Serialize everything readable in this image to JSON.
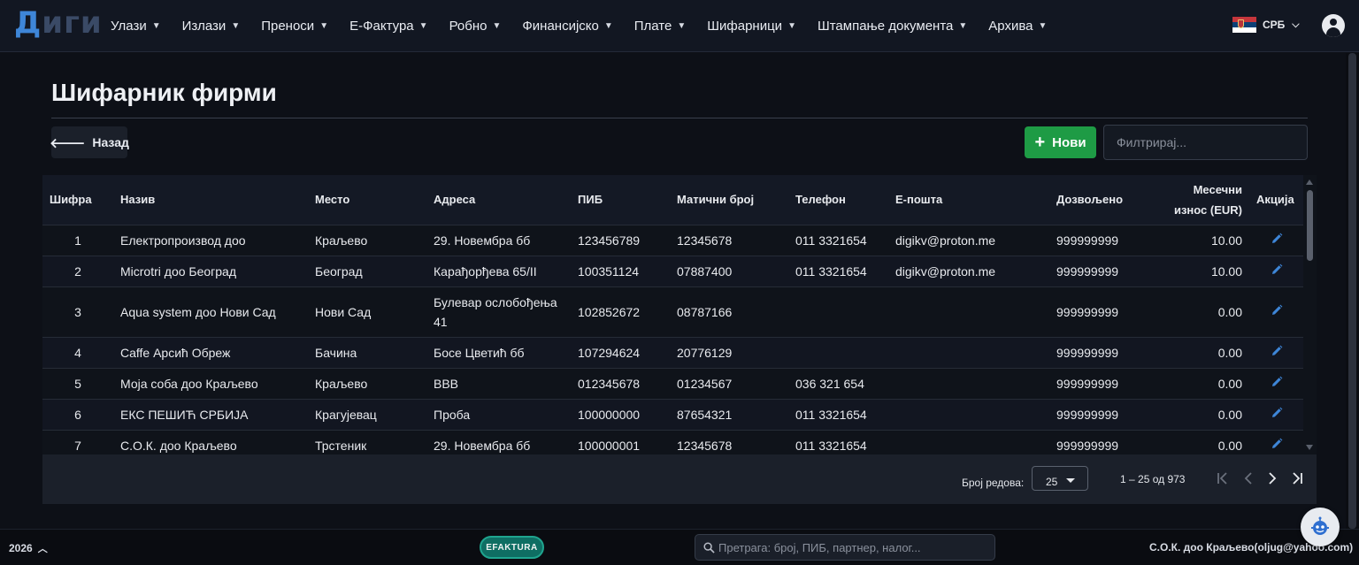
{
  "app": {
    "logo_first": "Д",
    "logo_rest": "иги"
  },
  "nav": {
    "items": [
      {
        "label": "Улази",
        "name": "nav-ulazi"
      },
      {
        "label": "Излази",
        "name": "nav-izlazi"
      },
      {
        "label": "Преноси",
        "name": "nav-prenosi"
      },
      {
        "label": "Е-Фактура",
        "name": "nav-efaktura"
      },
      {
        "label": "Робно",
        "name": "nav-robno"
      },
      {
        "label": "Финансијско",
        "name": "nav-finansijsko"
      },
      {
        "label": "Плате",
        "name": "nav-plate"
      },
      {
        "label": "Шифарници",
        "name": "nav-sifarnici"
      },
      {
        "label": "Штампање документа",
        "name": "nav-stampanje"
      },
      {
        "label": "Архива",
        "name": "nav-arhiva"
      }
    ],
    "language": "СРБ",
    "flag_colors": [
      "#c6363c",
      "#0c4076",
      "#ffffff"
    ]
  },
  "page": {
    "title": "Шифарник фирми",
    "back_label": "Назад",
    "new_label": "Нови",
    "filter_placeholder": "Филтрирај..."
  },
  "table": {
    "columns": {
      "sifra": "Шифра",
      "naziv": "Назив",
      "mesto": "Место",
      "adresa": "Адреса",
      "pib": "ПИБ",
      "maticni": "Матични број",
      "telefon": "Телефон",
      "email": "Е-пошта",
      "dozvoljeno": "Дозвољено",
      "mesecni_1": "Месечни",
      "mesecni_2": "износ (EUR)",
      "akcija": "Акција"
    },
    "rows": [
      {
        "sifra": "1",
        "naziv": "Електропроизвод доо",
        "mesto": "Краљево",
        "adresa": "29. Новембра бб",
        "pib": "123456789",
        "maticni": "12345678",
        "telefon": "011 3321654",
        "email": "digikv@proton.me",
        "dozvoljeno": "999999999",
        "iznos": "10.00"
      },
      {
        "sifra": "2",
        "naziv": "Microtri доо Београд",
        "mesto": "Београд",
        "adresa": "Карађорђева 65/II",
        "pib": "100351124",
        "maticni": "07887400",
        "telefon": "011 3321654",
        "email": "digikv@proton.me",
        "dozvoljeno": "999999999",
        "iznos": "10.00"
      },
      {
        "sifra": "3",
        "naziv": "Aqua system доо Нови Сад",
        "mesto": "Нови Сад",
        "adresa": "Булевар ослобођења 41",
        "pib": "102852672",
        "maticni": "08787166",
        "telefon": "",
        "email": "",
        "dozvoljeno": "999999999",
        "iznos": "0.00"
      },
      {
        "sifra": "4",
        "naziv": "Caffe Арсић Обреж",
        "mesto": "Бачина",
        "adresa": "Босе Цветић бб",
        "pib": "107294624",
        "maticni": "20776129",
        "telefon": "",
        "email": "",
        "dozvoljeno": "999999999",
        "iznos": "0.00"
      },
      {
        "sifra": "5",
        "naziv": "Моја соба доо Краљево",
        "mesto": "Краљево",
        "adresa": "ВВВ",
        "pib": "012345678",
        "maticni": "01234567",
        "telefon": "036 321 654",
        "email": "",
        "dozvoljeno": "999999999",
        "iznos": "0.00"
      },
      {
        "sifra": "6",
        "naziv": "ЕКС ПЕШИЋ СРБИЈА",
        "mesto": "Крагујевац",
        "adresa": "Проба",
        "pib": "100000000",
        "maticni": "87654321",
        "telefon": "011 3321654",
        "email": "",
        "dozvoljeno": "999999999",
        "iznos": "0.00"
      },
      {
        "sifra": "7",
        "naziv": "С.О.К. доо Краљево",
        "mesto": "Трстеник",
        "adresa": "29. Новембра бб",
        "pib": "100000001",
        "maticni": "12345678",
        "telefon": "011 3321654",
        "email": "",
        "dozvoljeno": "999999999",
        "iznos": "0.00"
      }
    ]
  },
  "paginator": {
    "rows_label": "Број редова:",
    "page_size": "25",
    "range": "1 – 25 од 973"
  },
  "footer": {
    "year": "2026",
    "efaktura_badge": "EFAKTURA",
    "search_placeholder": "Претрага: број, ПИБ, партнер, налог...",
    "company": "С.О.К. доо Краљево(oljug@yahoo.com)"
  }
}
